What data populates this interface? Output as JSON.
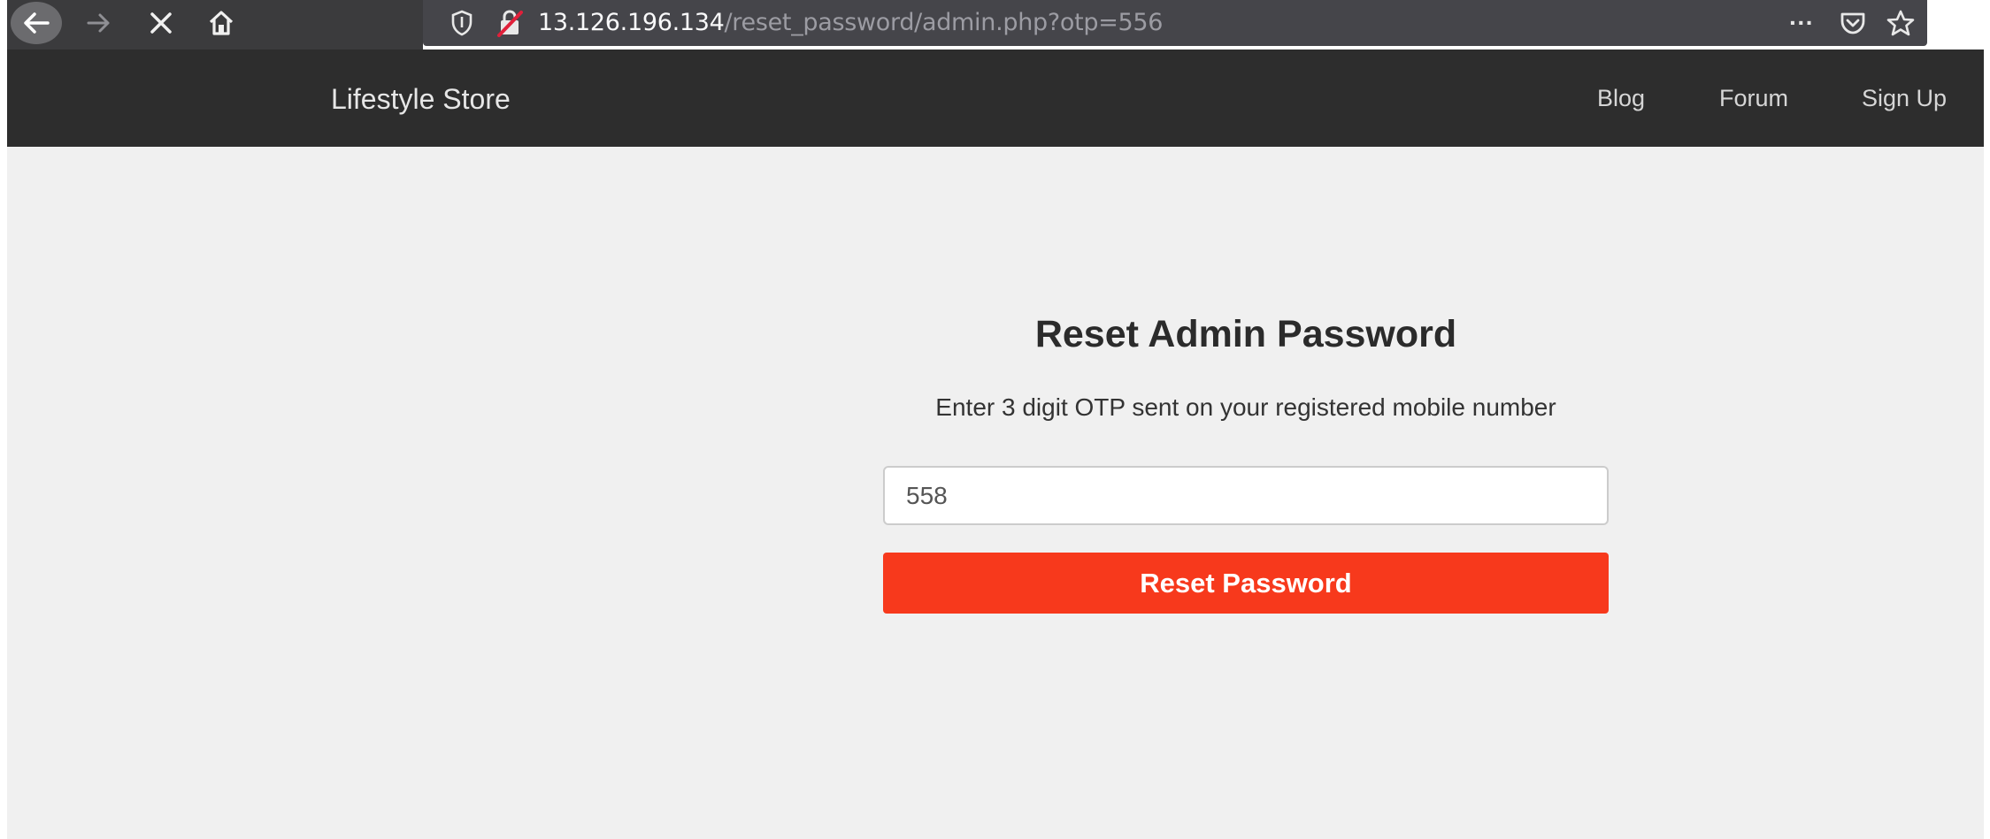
{
  "browser": {
    "url_host": "13.126.196.134",
    "url_path": "/reset_password/admin.php?otp=556",
    "icons": [
      "back-icon",
      "forward-icon",
      "stop-icon",
      "home-icon",
      "tracking-shield-icon",
      "insecure-lock-icon",
      "page-actions-icon",
      "pocket-icon",
      "bookmark-star-icon"
    ],
    "page_actions_label": "···"
  },
  "navbar": {
    "brand": "Lifestyle Store",
    "links": [
      "Blog",
      "Forum",
      "Sign Up"
    ]
  },
  "form": {
    "title": "Reset Admin Password",
    "subtitle": "Enter 3 digit OTP sent on your registered mobile number",
    "otp_value": "558",
    "button_label": "Reset Password"
  },
  "colors": {
    "navbar_bg": "#2d2d2d",
    "button_bg": "#f7391c",
    "page_bg": "#f0f0f0"
  }
}
